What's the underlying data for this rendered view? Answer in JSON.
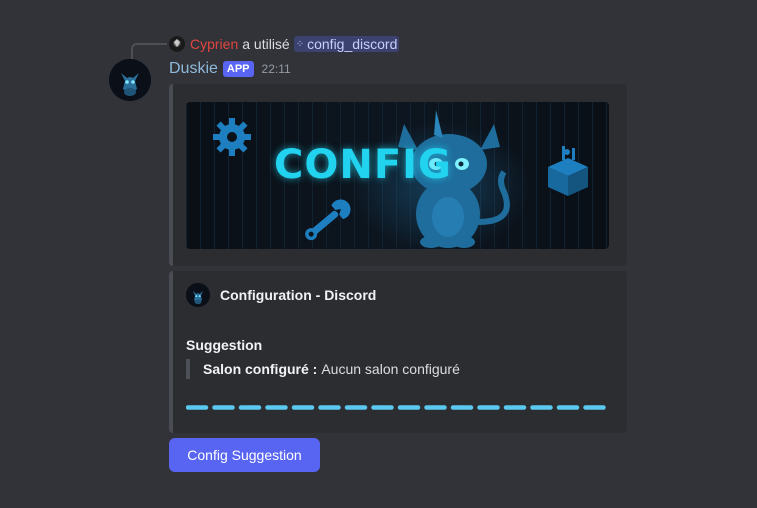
{
  "reply": {
    "user": "Cyprien",
    "action_text": "a utilisé",
    "command": "config_discord"
  },
  "message": {
    "author": "Duskie",
    "badge": "APP",
    "timestamp": "22:11"
  },
  "banner": {
    "text": "CONFIG"
  },
  "embed": {
    "author_name": "Configuration - Discord",
    "field_name": "Suggestion",
    "quote_label": "Salon configuré :",
    "quote_value": "Aucun salon configuré",
    "dash_color": "#5bc8f0"
  },
  "button": {
    "label": "Config Suggestion"
  },
  "colors": {
    "background": "#323339",
    "embed_bg": "#2b2d31",
    "blurple": "#5865f2",
    "username": "#8fb9da",
    "reply_user": "#e0463f",
    "banner_accent": "#22d3f0"
  }
}
